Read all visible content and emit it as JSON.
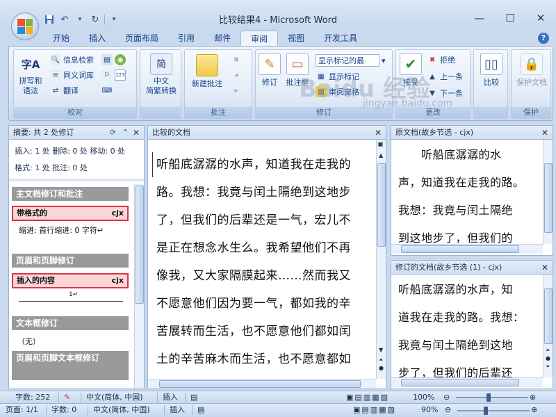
{
  "window": {
    "title": "比较结果4 - Microsoft Word",
    "minimize": "—",
    "maximize": "☐",
    "close": "✕"
  },
  "quick_access": {
    "save_icon": "save-icon",
    "undo_icon": "undo-icon",
    "redo_icon": "redo-icon"
  },
  "tabs": [
    {
      "label": "开始"
    },
    {
      "label": "插入"
    },
    {
      "label": "页面布局"
    },
    {
      "label": "引用"
    },
    {
      "label": "邮件"
    },
    {
      "label": "审阅",
      "active": true
    },
    {
      "label": "视图"
    },
    {
      "label": "开发工具"
    }
  ],
  "ribbon": {
    "proofing": {
      "label": "校对",
      "spelling": "拼写和\n语法",
      "research": "信息检索",
      "thesaurus": "同义词库",
      "translate": "翻译"
    },
    "chinese": {
      "convert": "中文\n简繁转换"
    },
    "comments": {
      "label": "批注",
      "new_comment": "新建批注"
    },
    "tracking": {
      "label": "修订",
      "track_changes": "修订",
      "balloons": "批注框",
      "display_combo": "显示标记的最",
      "show_markup": "显示标记",
      "reviewing_pane": "审阅窗格"
    },
    "changes": {
      "label": "更改",
      "accept": "接受",
      "reject": "拒绝",
      "previous": "上一条",
      "next": "下一条"
    },
    "compare": {
      "compare": "比较"
    },
    "protect": {
      "label": "保护",
      "protect_doc": "保护文档"
    }
  },
  "review_pane": {
    "summary": "摘要: 共 2 处修订",
    "line1": "插入: 1 处  删除: 0 处  移动: 0 处",
    "line2": "格式: 1 处  批注: 0 处",
    "sections": [
      {
        "title": "主文档修订和批注"
      },
      {
        "title": "页眉和页脚修订"
      },
      {
        "title": "文本框修订"
      },
      {
        "title": "页眉和页脚文本框修订"
      }
    ],
    "items": [
      {
        "type": "带格式的",
        "author": "cjx",
        "detail": "缩进: 首行缩进:   0 字符↵"
      },
      {
        "type": "插入的内容",
        "author": "cjx",
        "detail": "1↵"
      }
    ],
    "textbox_none": "（无）"
  },
  "compared_doc": {
    "title": "比较的文档",
    "lines": [
      "听船底潺潺的水声，知道我在走我的",
      "路。我想：我竟与闰土隔绝到这地步",
      "了，但我们的后辈还是一气，宏儿不",
      "是正在想念水生么。我希望他们不再",
      "像我，又大家隔膜起来……然而我又",
      "不愿意他们因为要一气，都如我的辛",
      "苦展转而生活，也不愿意他们都如闰",
      "土的辛苦麻木而生活，也不愿意都如"
    ]
  },
  "original_doc": {
    "title": "原文档(故乡节选 - cjx)",
    "lines": [
      "　　听船底潺潺的水",
      "声，知道我在走我的路。",
      "我想：我竟与闰土隔绝",
      "到这地步了，但我们的"
    ]
  },
  "revised_doc": {
    "title": "修订的文档(故乡节选 (1) - cjx)",
    "lines": [
      "听船底潺潺的水声，知",
      "道我在走我的路。我想：",
      "我竟与闰土隔绝到这地",
      "步了，但我们的后辈还"
    ]
  },
  "status_upper": {
    "words": "字数: 252",
    "language": "中文(简体, 中国)",
    "insert": "插入",
    "zoom": "100%"
  },
  "status_lower": {
    "page": "页面: 1/1",
    "words": "字数: 0",
    "language": "中文(简体, 中国)",
    "insert": "插入",
    "zoom": "90%"
  },
  "watermark": {
    "text": "Baidu 经验",
    "url": "jingyan.baidu.com"
  },
  "colors": {
    "accent": "#15428b",
    "revision_border": "#e0314b",
    "revision_fill": "#fbd6d6",
    "section_gray": "#9a9a9a"
  }
}
